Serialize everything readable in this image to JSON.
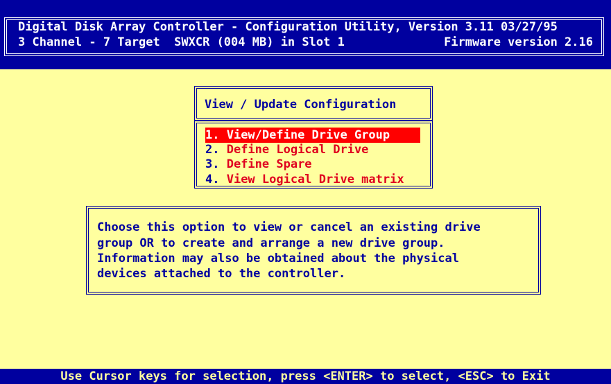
{
  "header": {
    "line1": "Digital Disk Array Controller - Configuration Utility, Version 3.11 03/27/95",
    "line2_left": "3 Channel - 7 Target  SWXCR (004 MB) in Slot 1",
    "line2_right": "Firmware version 2.16"
  },
  "menu": {
    "title": "View / Update Configuration",
    "items": [
      {
        "num": "1.",
        "label": " View/Define Drive Group",
        "selected": true
      },
      {
        "num": "2.",
        "label": " Define Logical Drive",
        "selected": false
      },
      {
        "num": "3.",
        "label": " Define Spare",
        "selected": false
      },
      {
        "num": "4.",
        "label": " View Logical Drive matrix",
        "selected": false
      }
    ]
  },
  "help": {
    "lines": [
      "Choose this option to view or cancel an existing drive",
      "group OR to create and arrange a new drive group.",
      "Information may also be obtained about the physical",
      "devices attached to the controller."
    ]
  },
  "status": {
    "text": "Use Cursor keys for selection, press <ENTER> to select, <ESC> to Exit"
  },
  "colors": {
    "background": "#ffff9f",
    "dark_blue": "#00009f",
    "menu_red": "#e0001f",
    "highlight_red": "#ff0000",
    "white": "#ffffff"
  }
}
